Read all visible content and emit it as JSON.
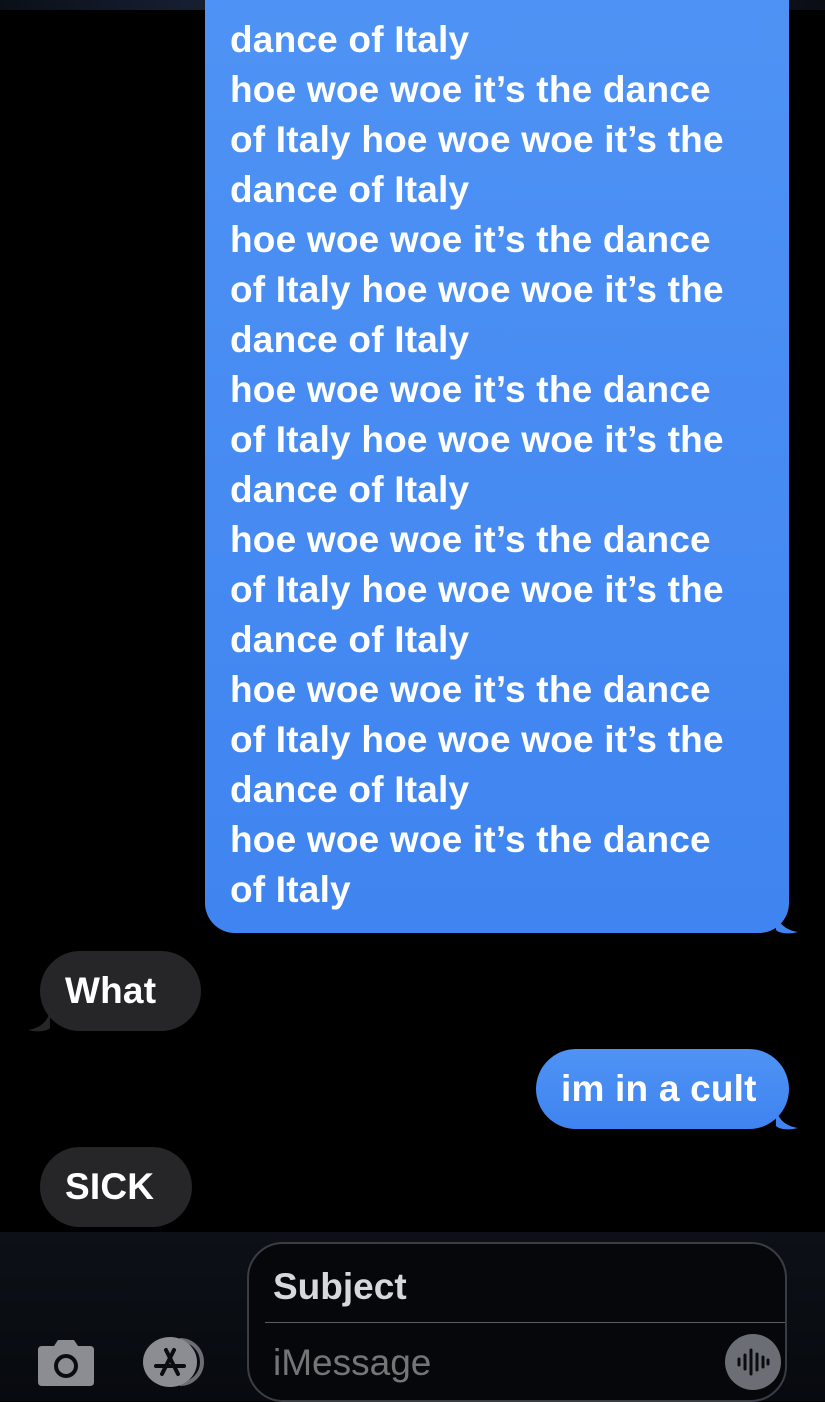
{
  "thread": {
    "big_message": {
      "lines": [
        "dance of Italy",
        "hoe woe woe it’s the dance",
        "of Italy hoe woe woe it’s the",
        "dance of Italy",
        "hoe woe woe it’s the dance",
        "of Italy hoe woe woe it’s the",
        "dance of Italy",
        "hoe woe woe it’s the dance",
        "of Italy hoe woe woe it’s the",
        "dance of Italy",
        "hoe woe woe it’s the dance",
        "of Italy hoe woe woe it’s the",
        "dance of Italy",
        "hoe woe woe it’s the dance",
        "of Italy hoe woe woe it’s the",
        "dance of Italy",
        "hoe woe woe it’s the dance",
        "of Italy"
      ]
    },
    "received_1": "What",
    "sent_2": "im in a cult",
    "received_2": "SICK"
  },
  "input": {
    "subject_label": "Subject",
    "message_placeholder": "iMessage"
  },
  "icons": {
    "camera": "camera-icon",
    "app_store": "app-store-icon",
    "audio": "audio-waveform-icon"
  },
  "colors": {
    "sent_bubble": "#3f84f0",
    "received_bubble": "#262628",
    "background": "#000000"
  }
}
